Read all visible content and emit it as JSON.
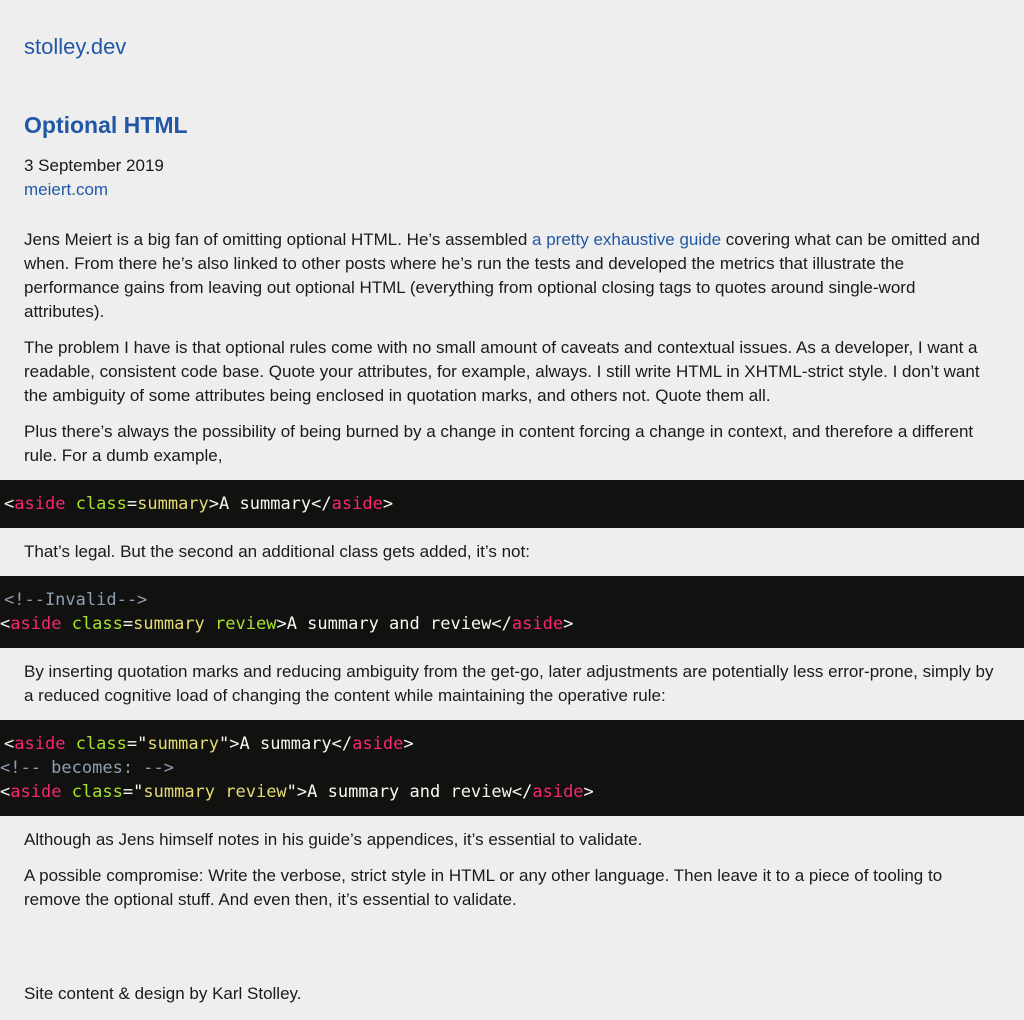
{
  "site": {
    "name": "stolley.dev"
  },
  "post": {
    "title": "Optional HTML",
    "date": "3 September 2019",
    "source": "meiert.com"
  },
  "paragraphs": {
    "p1_before": "Jens Meiert is a big fan of omitting optional HTML. He’s assembled ",
    "p1_link": "a pretty exhaustive guide",
    "p1_after": " covering what can be omitted and when. From there he’s also linked to other posts where he’s run the tests and developed the metrics that illustrate the performance gains from leaving out optional HTML (everything from optional closing tags to quotes around single-word attributes).",
    "p2": "The problem I have is that optional rules come with no small amount of caveats and contextual issues. As a developer, I want a readable, consistent code base. Quote your attributes, for example, always. I still write HTML in XHTML-strict style. I don’t want the ambiguity of some attributes being enclosed in quotation marks, and others not. Quote them all.",
    "p3": "Plus there’s always the possibility of being burned by a change in content forcing a change in context, and therefore a different rule. For a dumb example,",
    "p4": "That’s legal. But the second an additional class gets added, it’s not:",
    "p5": "By inserting quotation marks and reducing ambiguity from the get-go, later adjustments are potentially less error-prone, simply by a reduced cognitive load of changing the content while maintaining the operative rule:",
    "p6": "Although as Jens himself notes in his guide’s appendices, it’s essential to validate.",
    "p7": "A possible compromise: Write the verbose, strict style in HTML or any other language. Then leave it to a piece of tooling to remove the optional stuff. And even then, it’s essential to validate."
  },
  "code": {
    "lt": "<",
    "gt": ">",
    "close_lt": "</",
    "eq": "=",
    "quote": "\"",
    "tag": "aside",
    "attr": "class",
    "val1": "summary",
    "val2": "summary review",
    "text1": "A summary",
    "text2": "A summary and review",
    "comment_invalid": "<!--Invalid-->",
    "comment_becomes": "<!-- becomes: -->"
  },
  "footer": {
    "text": "Site content & design by Karl Stolley."
  }
}
